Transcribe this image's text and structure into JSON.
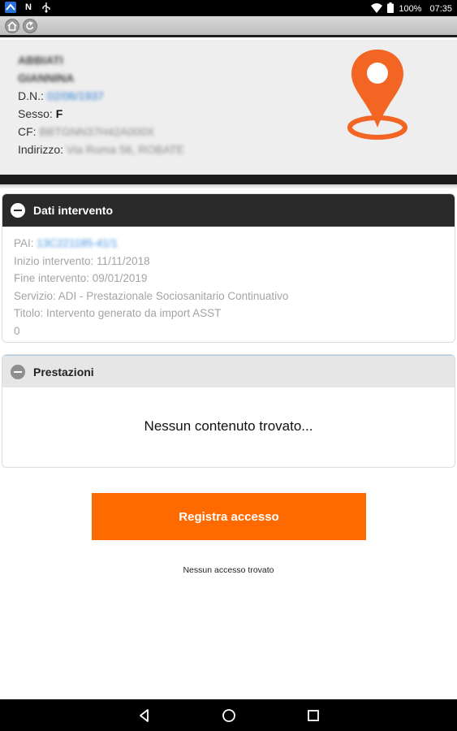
{
  "status_bar": {
    "battery": "100%",
    "time": "07:35",
    "icons": [
      "app-icon",
      "nfc-icon",
      "usb-icon",
      "wifi-icon",
      "battery-icon"
    ]
  },
  "toolbar": {
    "buttons": [
      "home-icon",
      "back-icon"
    ]
  },
  "patient": {
    "surname": "ABBIATI",
    "name": "GIANNINA",
    "dn_label": "D.N.:",
    "dn_value": "02/06/1937",
    "sesso_label": "Sesso:",
    "sesso_value": "F",
    "cf_label": "CF:",
    "cf_value": "BBTGNN37H42A000X",
    "indirizzo_label": "Indirizzo:",
    "indirizzo_value": "Via Roma 56, ROBATE",
    "pin_color": "#f26522"
  },
  "dati_intervento": {
    "title": "Dati intervento",
    "pai_label": "PAI:",
    "pai_value": "13C221185-41/1",
    "inizio": "Inizio intervento: 11/11/2018",
    "fine": "Fine intervento: 09/01/2019",
    "servizio": "Servizio: ADI - Prestazionale Sociosanitario Continuativo",
    "titolo": "Titolo: Intervento generato da import ASST",
    "extra": "0"
  },
  "prestazioni": {
    "title": "Prestazioni",
    "empty_message": "Nessun contenuto trovato..."
  },
  "actions": {
    "registra_label": "Registra accesso",
    "accent_color": "#ff6a00",
    "nessun_accesso": "Nessun accesso trovato"
  },
  "navbar": {
    "buttons": [
      "nav-back-icon",
      "nav-home-icon",
      "nav-recent-icon"
    ]
  }
}
